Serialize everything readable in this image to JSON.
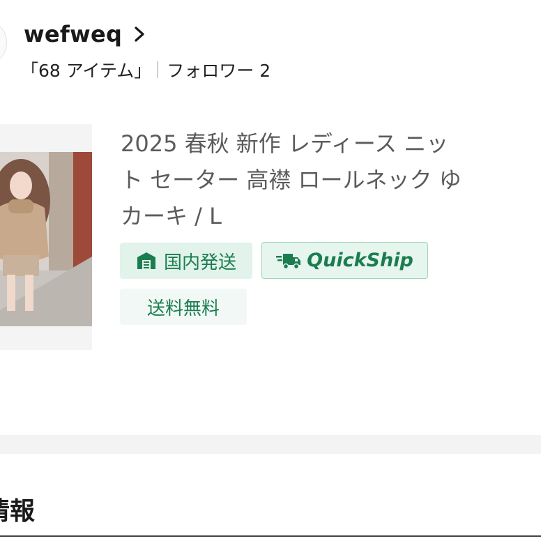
{
  "shop": {
    "name": "wefweq",
    "items": "「68 アイテム」",
    "followers": "フォロワー 2"
  },
  "product": {
    "title_line1": "2025 春秋 新作 レディース ニッ",
    "title_line2": "ト セーター 高襟 ロールネック ゆ",
    "title_line3": "カーキ / L",
    "badges": {
      "domestic": "国内発送",
      "quickship": "QuickShip",
      "free_shipping": "送料無料"
    }
  },
  "section": {
    "title": "情報"
  },
  "icons": {
    "shop_arrow": "chevron-right-icon",
    "warehouse": "warehouse-icon",
    "truck": "delivery-truck-icon"
  },
  "colors": {
    "badge_green": "#1b7d4f",
    "badge_bg": "#e1f3ea",
    "title_gray": "#5b5b5b"
  }
}
